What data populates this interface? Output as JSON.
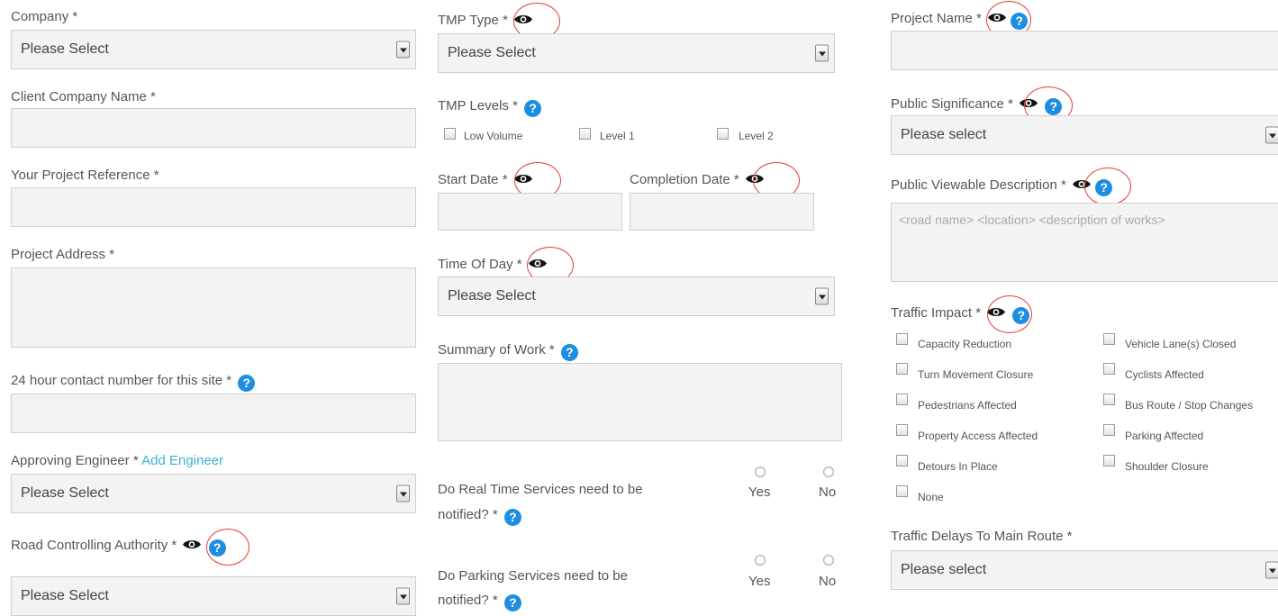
{
  "col1": {
    "company_label": "Company *",
    "company_value": "Please Select",
    "client_label": "Client Company Name *",
    "ref_label": "Your Project Reference *",
    "address_label": "Project Address *",
    "contact_label": "24 hour contact number for this site *",
    "engineer_label": "Approving Engineer *",
    "engineer_link": "Add Engineer",
    "engineer_value": "Please Select",
    "authority_label": "Road Controlling Authority *",
    "authority_value": "Please Select"
  },
  "col2": {
    "tmp_type_label": "TMP Type *",
    "tmp_type_value": "Please Select",
    "tmp_levels_label": "TMP Levels *",
    "levels": [
      "Low Volume",
      "Level 1",
      "Level 2"
    ],
    "start_label": "Start Date *",
    "completion_label": "Completion Date *",
    "tod_label": "Time Of Day *",
    "tod_value": "Please Select",
    "summary_label": "Summary of Work *",
    "rts_q1": "Do Real Time Services need to be",
    "rts_q2": "notified? *",
    "parking_q1": "Do Parking Services need to be",
    "parking_q2": "notified? *",
    "yes": "Yes",
    "no": "No"
  },
  "col3": {
    "project_name_label": "Project Name *",
    "significance_label": "Public Significance *",
    "significance_value": "Please select",
    "desc_label": "Public Viewable Description *",
    "desc_placeholder": "<road name> <location> <description of works>",
    "impact_label": "Traffic Impact *",
    "impacts_left": [
      "Capacity Reduction",
      "Turn Movement Closure",
      "Pedestrians Affected",
      "Property Access Affected",
      "Detours In Place",
      "None"
    ],
    "impacts_right": [
      "Vehicle Lane(s) Closed",
      "Cyclists Affected",
      "Bus Route / Stop Changes",
      "Parking Affected",
      "Shoulder Closure"
    ],
    "delays_label": "Traffic Delays To Main Route *",
    "delays_value": "Please select"
  },
  "icons": {
    "help_glyph": "?",
    "eye": "eye-icon",
    "help": "help-icon",
    "annotation": "red-circle"
  },
  "colors": {
    "help": "#1e8ee0",
    "link": "#3bb0d6",
    "annotation": "#e23b3b"
  }
}
